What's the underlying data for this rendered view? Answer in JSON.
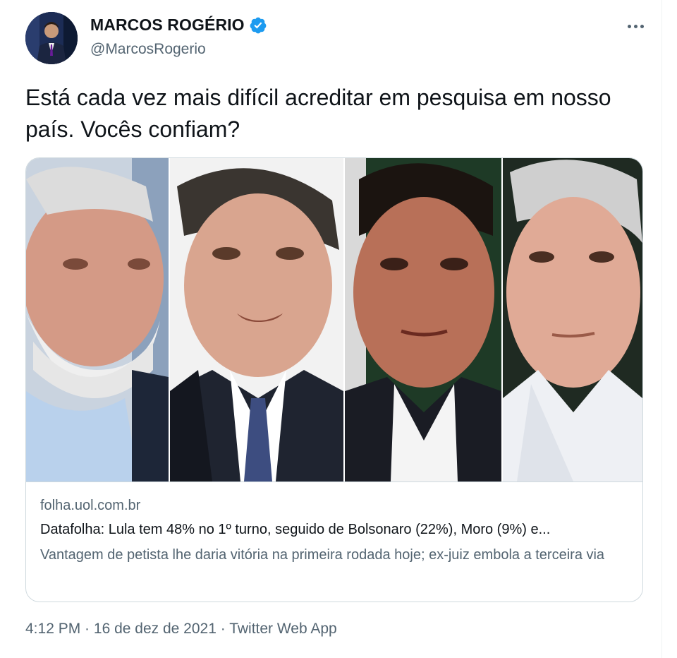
{
  "author": {
    "name": "MARCOS ROGÉRIO",
    "handle": "@MarcosRogerio",
    "verified_color": "#1d9bf0"
  },
  "tweet": {
    "text": "Está cada vez mais difícil acreditar em pesquisa em nosso país. Vocês confiam?"
  },
  "card": {
    "domain": "folha.uol.com.br",
    "title": "Datafolha: Lula tem 48% no 1º turno, seguido de Bolsonaro (22%), Moro (9%) e...",
    "description": "Vantagem de petista lhe daria vitória na primeira rodada hoje; ex-juiz embola a terceira via",
    "image_icon": "four-politicians-photo-collage"
  },
  "meta": {
    "time": "4:12 PM",
    "separator": " · ",
    "date": "16 de dez de 2021",
    "source": "Twitter Web App"
  },
  "icons": {
    "more": "more-icon",
    "verified": "verified-badge-icon"
  },
  "colors": {
    "text_primary": "#0f1419",
    "text_secondary": "#536471",
    "border": "#cfd9de",
    "accent": "#1d9bf0"
  }
}
